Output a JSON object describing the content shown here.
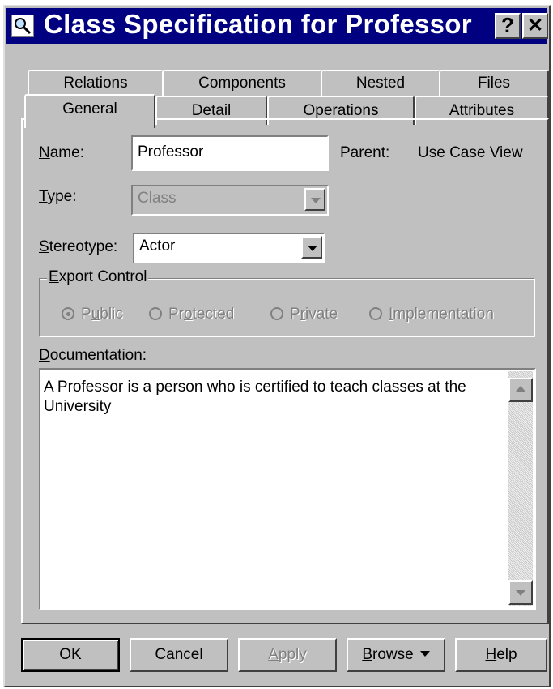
{
  "window": {
    "title": "Class Specification for Professor",
    "help_label": "?",
    "close_label": "✕"
  },
  "tabs": {
    "row1": [
      "Relations",
      "Components",
      "Nested",
      "Files"
    ],
    "row2": [
      "General",
      "Detail",
      "Operations",
      "Attributes"
    ],
    "active": "General"
  },
  "form": {
    "name_label_u": "N",
    "name_label_rest": "ame:",
    "name_value": "Professor",
    "parent_label": "Parent:",
    "parent_value": "Use Case View",
    "type_label_u": "T",
    "type_label_rest": "ype:",
    "type_value": "Class",
    "stereotype_label_u": "S",
    "stereotype_label_rest": "tereotype:",
    "stereotype_value": "Actor"
  },
  "export_control": {
    "legend_u": "E",
    "legend_rest": "xport Control",
    "options": [
      {
        "pre": "P",
        "u": "u",
        "post": "blic",
        "selected": true
      },
      {
        "pre": "Pr",
        "u": "o",
        "post": "tected",
        "selected": false
      },
      {
        "pre": "P",
        "u": "r",
        "post": "ivate",
        "selected": false
      },
      {
        "pre": "",
        "u": "I",
        "post": "mplementation",
        "selected": false
      }
    ]
  },
  "documentation": {
    "label_u": "D",
    "label_rest": "ocumentation:",
    "text": "A Professor is a person who is certified to teach classes at the University"
  },
  "buttons": {
    "ok": "OK",
    "cancel": "Cancel",
    "apply_u": "A",
    "apply_rest": "pply",
    "browse_u": "B",
    "browse_rest": "rowse",
    "help_u": "H",
    "help_rest": "elp"
  }
}
